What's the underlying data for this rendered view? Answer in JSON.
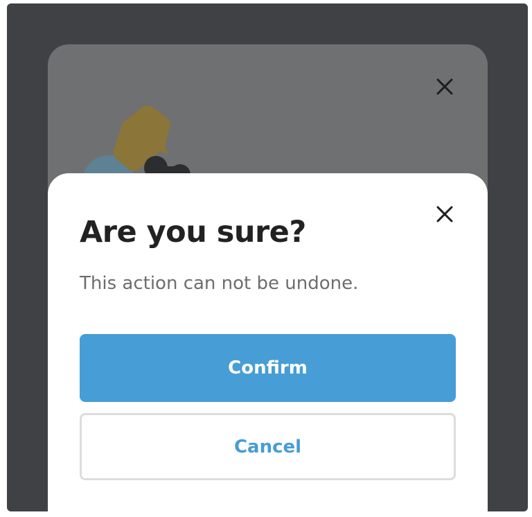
{
  "dialog": {
    "title": "Are you sure?",
    "message": "This action can not be undone.",
    "confirm_label": "Confirm",
    "cancel_label": "Cancel"
  },
  "icons": {
    "back_close": "close-icon",
    "dialog_close": "close-icon",
    "illustration": "chat-bubbles-icon"
  },
  "colors": {
    "overlay": "#404144",
    "back_sheet": "#6f7072",
    "primary": "#479dd5",
    "title_text": "#222222",
    "message_text": "#6d6d6d",
    "cancel_border": "#dcdcdc"
  }
}
